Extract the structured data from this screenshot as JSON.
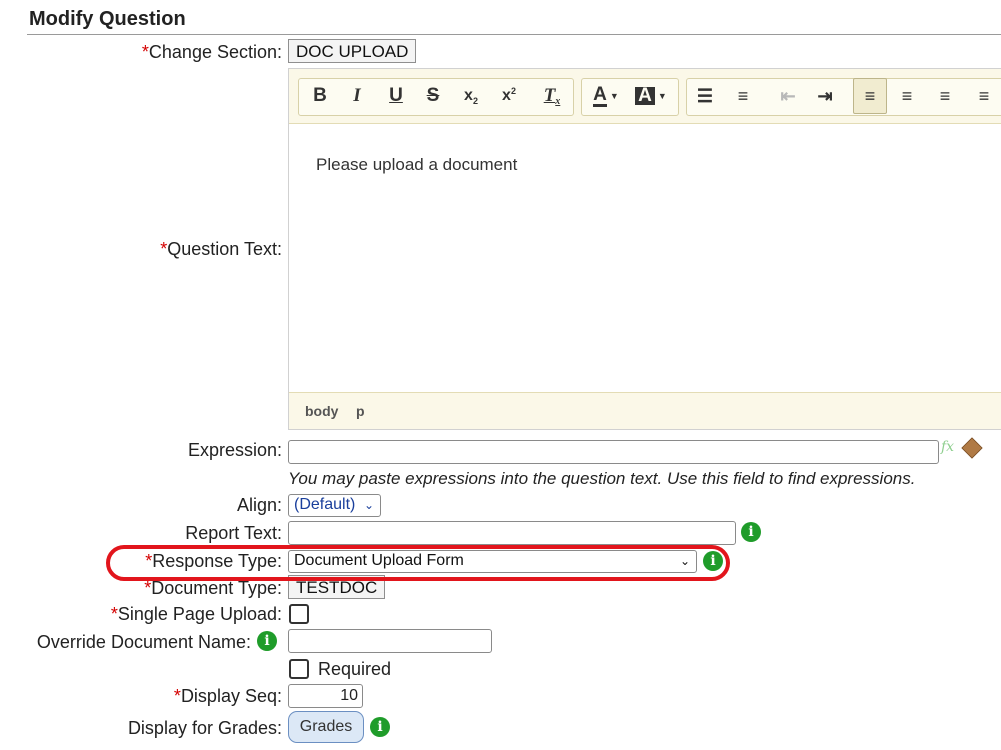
{
  "page": {
    "title": "Modify Question"
  },
  "fields": {
    "change_section": {
      "label": "Change Section:",
      "value": "DOC UPLOAD"
    },
    "question_text": {
      "label": "Question Text:"
    },
    "expression": {
      "label": "Expression:",
      "value": "",
      "hint": "You may paste expressions into the question text. Use this field to find expressions."
    },
    "align": {
      "label": "Align:",
      "value": "(Default)"
    },
    "report_text": {
      "label": "Report Text:",
      "value": ""
    },
    "response_type": {
      "label": "Response Type:",
      "value": "Document Upload Form"
    },
    "document_type": {
      "label": "Document Type:",
      "value": "TESTDOC"
    },
    "single_page_upload": {
      "label": "Single Page Upload:"
    },
    "override_document_name": {
      "label": "Override Document Name:",
      "value": ""
    },
    "required": {
      "label": "Required"
    },
    "display_seq": {
      "label": "Display Seq:",
      "value": "10"
    },
    "display_for_grades": {
      "label": "Display for Grades:",
      "button": "Grades"
    }
  },
  "editor": {
    "content": "Please upload a document",
    "path": [
      "body",
      "p"
    ],
    "toolbar": [
      "bold",
      "italic",
      "underline",
      "strikethrough",
      "subscript",
      "superscript",
      "remove-format",
      "text-color",
      "background-color",
      "numbered-list",
      "bulleted-list",
      "decrease-indent",
      "increase-indent",
      "align-left",
      "align-center",
      "align-right",
      "justify"
    ]
  },
  "required_marker": "*",
  "colors": {
    "required": "#d40000",
    "info": "#1f9c2a",
    "highlight": "#e2151c",
    "toolbar": "#fbf8e8"
  }
}
